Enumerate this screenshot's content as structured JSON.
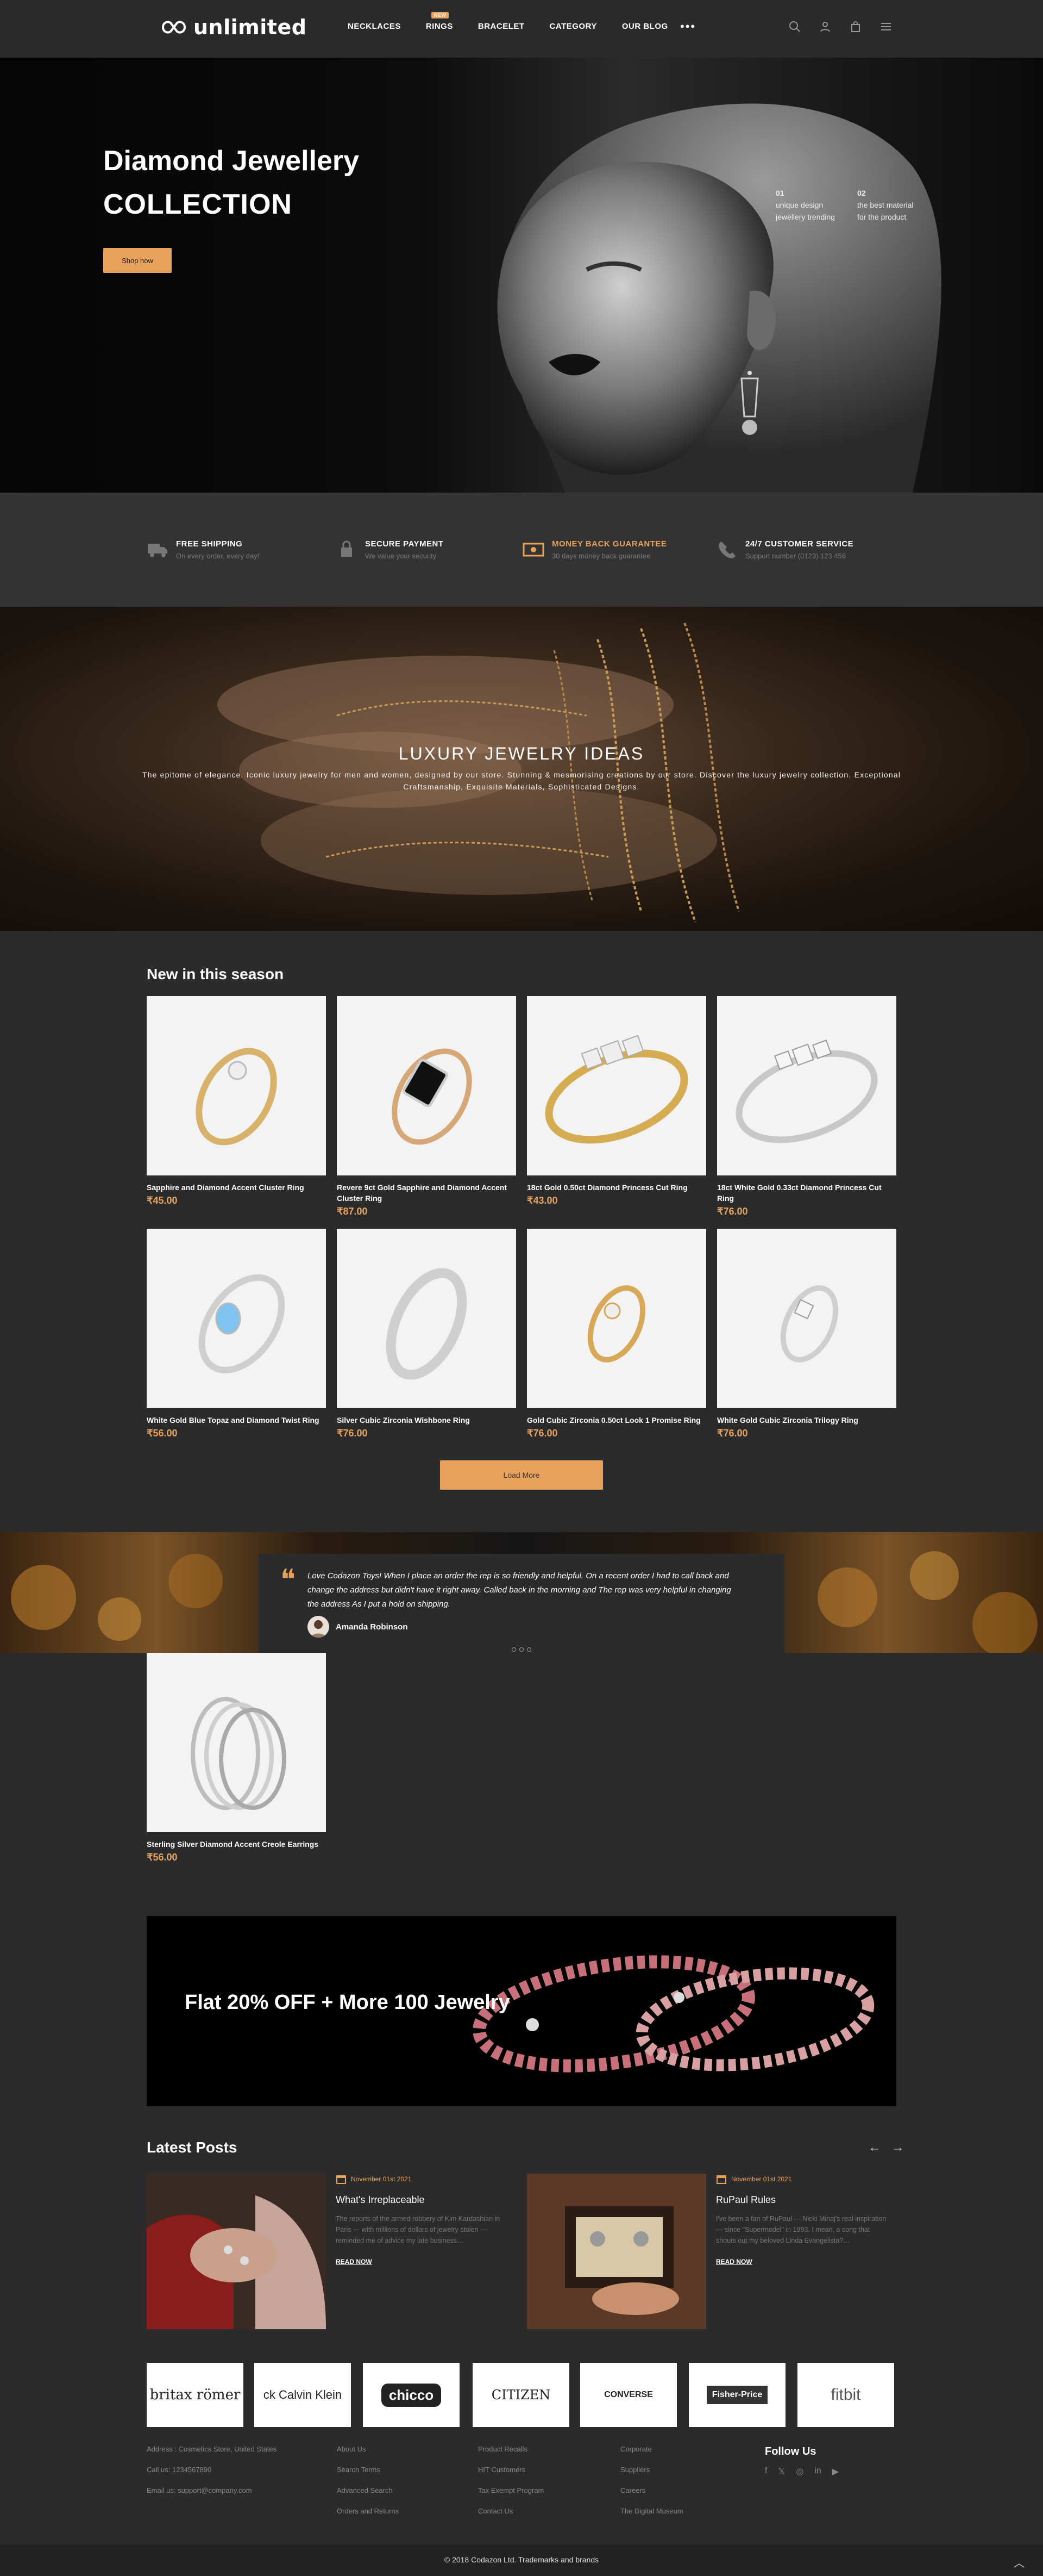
{
  "header": {
    "logo": "unlimited",
    "nav": [
      {
        "label": "NECKLACES"
      },
      {
        "label": "RINGS",
        "badge": "NEW"
      },
      {
        "label": "BRACELET"
      },
      {
        "label": "CATEGORY"
      },
      {
        "label": "OUR BLOG"
      }
    ],
    "more": "•••",
    "icons": [
      "search-icon",
      "user-icon",
      "bag-icon",
      "menu-icon"
    ]
  },
  "hero": {
    "title_line1": "Diamond Jewellery",
    "title_line2": "COLLECTION",
    "button": "Shop now",
    "features": [
      {
        "num": "01",
        "line1": "unique design",
        "line2": "jewellery trending"
      },
      {
        "num": "02",
        "line1": "the best material",
        "line2": "for the product"
      }
    ]
  },
  "services": [
    {
      "icon": "truck-icon",
      "title": "FREE SHIPPING",
      "subtitle": "On every order, every day!"
    },
    {
      "icon": "lock-icon",
      "title": "SECURE PAYMENT",
      "subtitle": "We value your security"
    },
    {
      "icon": "money-icon",
      "title": "MONEY BACK GUARANTEE",
      "subtitle": "30 days money back guarantee",
      "highlight": "#e8a25c"
    },
    {
      "icon": "phone-icon",
      "title": "24/7 CUSTOMER SERVICE",
      "subtitle": "Support number (0123) 123 456"
    }
  ],
  "luxury": {
    "title": "LUXURY JEWELRY IDEAS",
    "subtitle": "The epitome of elegance. Iconic luxury jewelry for men and women, designed by our store. Stunning & mesmorising creations by our store. Discover the luxury jewelry collection. Exceptional Craftsmanship, Exquisite Materials, Sophisticated Designs."
  },
  "season": {
    "title": "New in this season",
    "products": [
      {
        "name": "Sapphire and Diamond Accent Cluster Ring",
        "price": "₹45.00"
      },
      {
        "name": "Revere 9ct Gold Sapphire and Diamond Accent Cluster Ring",
        "price": "₹87.00"
      },
      {
        "name": "18ct Gold 0.50ct Diamond Princess Cut Ring",
        "price": "₹43.00"
      },
      {
        "name": "18ct White Gold 0.33ct Diamond Princess Cut Ring",
        "price": "₹76.00"
      },
      {
        "name": "White Gold Blue Topaz and Diamond Twist Ring",
        "price": "₹56.00"
      },
      {
        "name": "Silver Cubic Zirconia Wishbone Ring",
        "price": "₹76.00"
      },
      {
        "name": "Gold Cubic Zirconia 0.50ct Look 1 Promise Ring",
        "price": "₹76.00"
      },
      {
        "name": "White Gold Cubic Zirconia Trilogy Ring",
        "price": "₹76.00"
      },
      {
        "name": "Sterling Silver Diamond Accent Creole Earrings",
        "price": "₹56.00"
      }
    ],
    "load_more": "Load More"
  },
  "testimonial": {
    "quote": "Love Codazon Toys! When I place an order the rep is so friendly and helpful. On a recent order I had to call back and change the address but didn't have it right away. Called back in the morning and The rep was very helpful in changing the address As I put a hold on shipping.",
    "author": "Amanda Robinson"
  },
  "offer": {
    "text": "Flat 20% OFF + More 100 Jewelry"
  },
  "posts": {
    "title": "Latest Posts",
    "arrows": "← →",
    "items": [
      {
        "date": "November 01st 2021",
        "title": "What's Irreplaceable",
        "excerpt": "The reports of the armed robbery of Kim Kardashian in Paris — with millions of dollars of jewelry stolen — reminded me of advice my late business…",
        "read_more": "READ NOW"
      },
      {
        "date": "November 01st 2021",
        "title": "RuPaul Rules",
        "excerpt": "I've been a fan of RuPaul — Nicki Minaj's real inspiration — since \"Supermodel\" in 1993. I mean, a song that shouts out my beloved Linda Evangelista?…",
        "read_more": "READ NOW"
      }
    ]
  },
  "brands": [
    "britax römer",
    "ck Calvin Klein",
    "chicco",
    "CITIZEN",
    "CONVERSE",
    "Fisher-Price",
    "fitbit"
  ],
  "footer": {
    "contact": [
      "Address : Cosmetics Store, United States",
      "Call us: 1234567890",
      "Email us: support@company.com"
    ],
    "col1": [
      "About Us",
      "Search Terms",
      "Advanced Search",
      "Orders and Returns"
    ],
    "col2": [
      "Product Recalls",
      "HIT Customers",
      "Tax Exempt Program",
      "Contact Us"
    ],
    "col3": [
      "Corporate",
      "Suppliers",
      "Careers",
      "The Digital Museum"
    ],
    "follow_title": "Follow Us",
    "social": [
      "f",
      "𝕏",
      "◎",
      "in",
      "▶"
    ],
    "copyright": "© 2018 Codazon Ltd. Trademarks and brands"
  },
  "colors": {
    "accent": "#e8a25c",
    "background": "#2b2b2b"
  }
}
